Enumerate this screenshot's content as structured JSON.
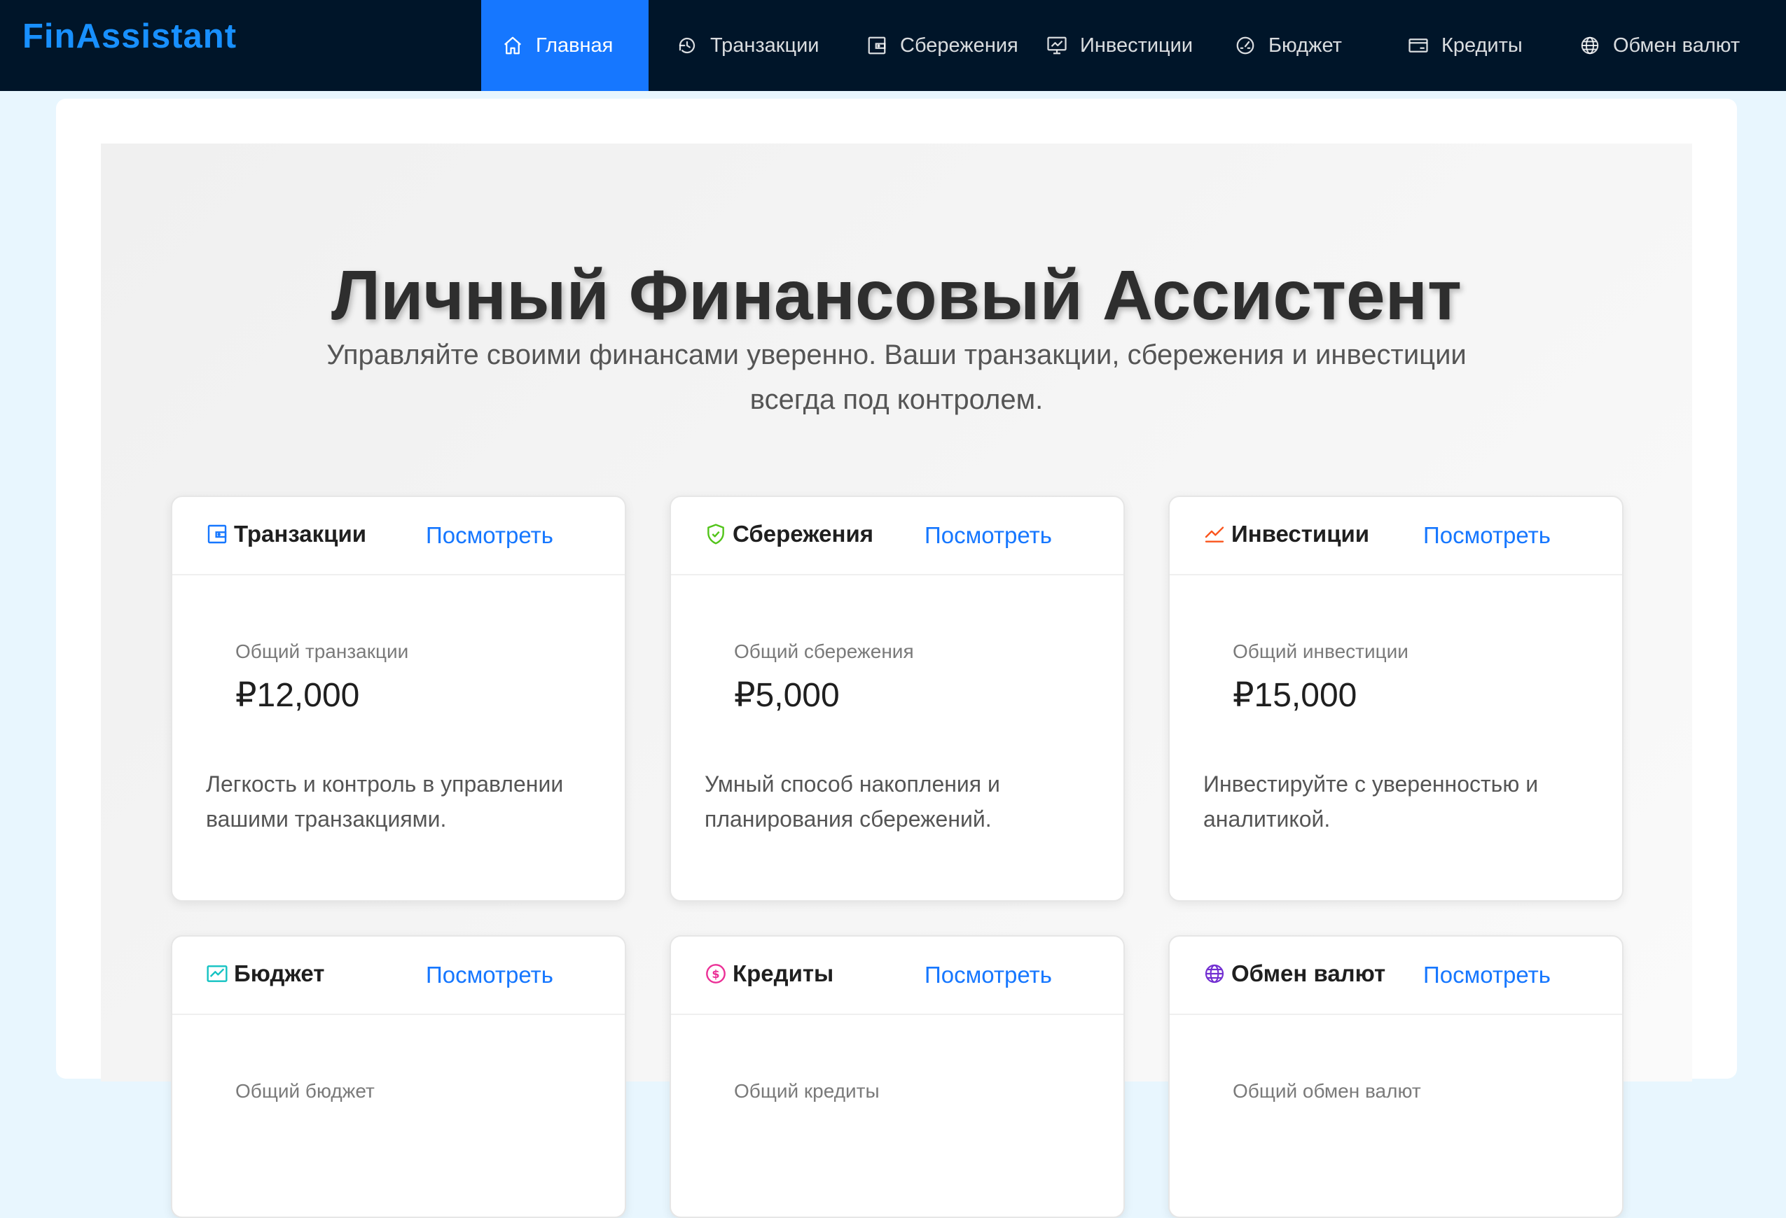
{
  "brand": "FinAssistant",
  "nav": {
    "items": [
      {
        "label": "Главная",
        "icon": "home-icon",
        "active": true
      },
      {
        "label": "Транзакции",
        "icon": "transactions-icon"
      },
      {
        "label": "Сбережения",
        "icon": "wallet-icon"
      },
      {
        "label": "Инвестиции",
        "icon": "fund-chart-icon"
      },
      {
        "label": "Бюджет",
        "icon": "dashboard-gauge-icon"
      },
      {
        "label": "Кредиты",
        "icon": "credit-card-icon"
      },
      {
        "label": "Обмен валют",
        "icon": "globe-icon"
      }
    ]
  },
  "hero": {
    "title": "Личный Финансовый Ассистент",
    "subtitle": "Управляйте своими финансами уверенно. Ваши транзакции, сбережения и инвестиции всегда под контролем."
  },
  "cards": [
    {
      "title": "Транзакции",
      "icon": "wallet-icon",
      "icon_color": "#1677ff",
      "link": "Посмотреть",
      "stat_label": "Общий транзакции",
      "stat_value": "₽12,000",
      "desc": "Легкость и контроль в управлении вашими транзакциями."
    },
    {
      "title": "Сбережения",
      "icon": "safety-shield-icon",
      "icon_color": "#52c41a",
      "link": "Посмотреть",
      "stat_label": "Общий сбережения",
      "stat_value": "₽5,000",
      "desc": "Умный способ накопления и планирования сбережений."
    },
    {
      "title": "Инвестиции",
      "icon": "rise-line-icon",
      "icon_color": "#fa541c",
      "link": "Посмотреть",
      "stat_label": "Общий инвестиции",
      "stat_value": "₽15,000",
      "desc": "Инвестируйте с уверенностью и аналитикой."
    },
    {
      "title": "Бюджет",
      "icon": "stock-chart-icon",
      "icon_color": "#13c2c2",
      "link": "Посмотреть",
      "stat_label": "Общий бюджет"
    },
    {
      "title": "Кредиты",
      "icon": "dollar-circle-icon",
      "icon_color": "#eb2f96",
      "link": "Посмотреть",
      "stat_label": "Общий кредиты"
    },
    {
      "title": "Обмен валют",
      "icon": "globe-icon",
      "icon_color": "#722ed1",
      "link": "Посмотреть",
      "stat_label": "Общий обмен валют"
    }
  ]
}
